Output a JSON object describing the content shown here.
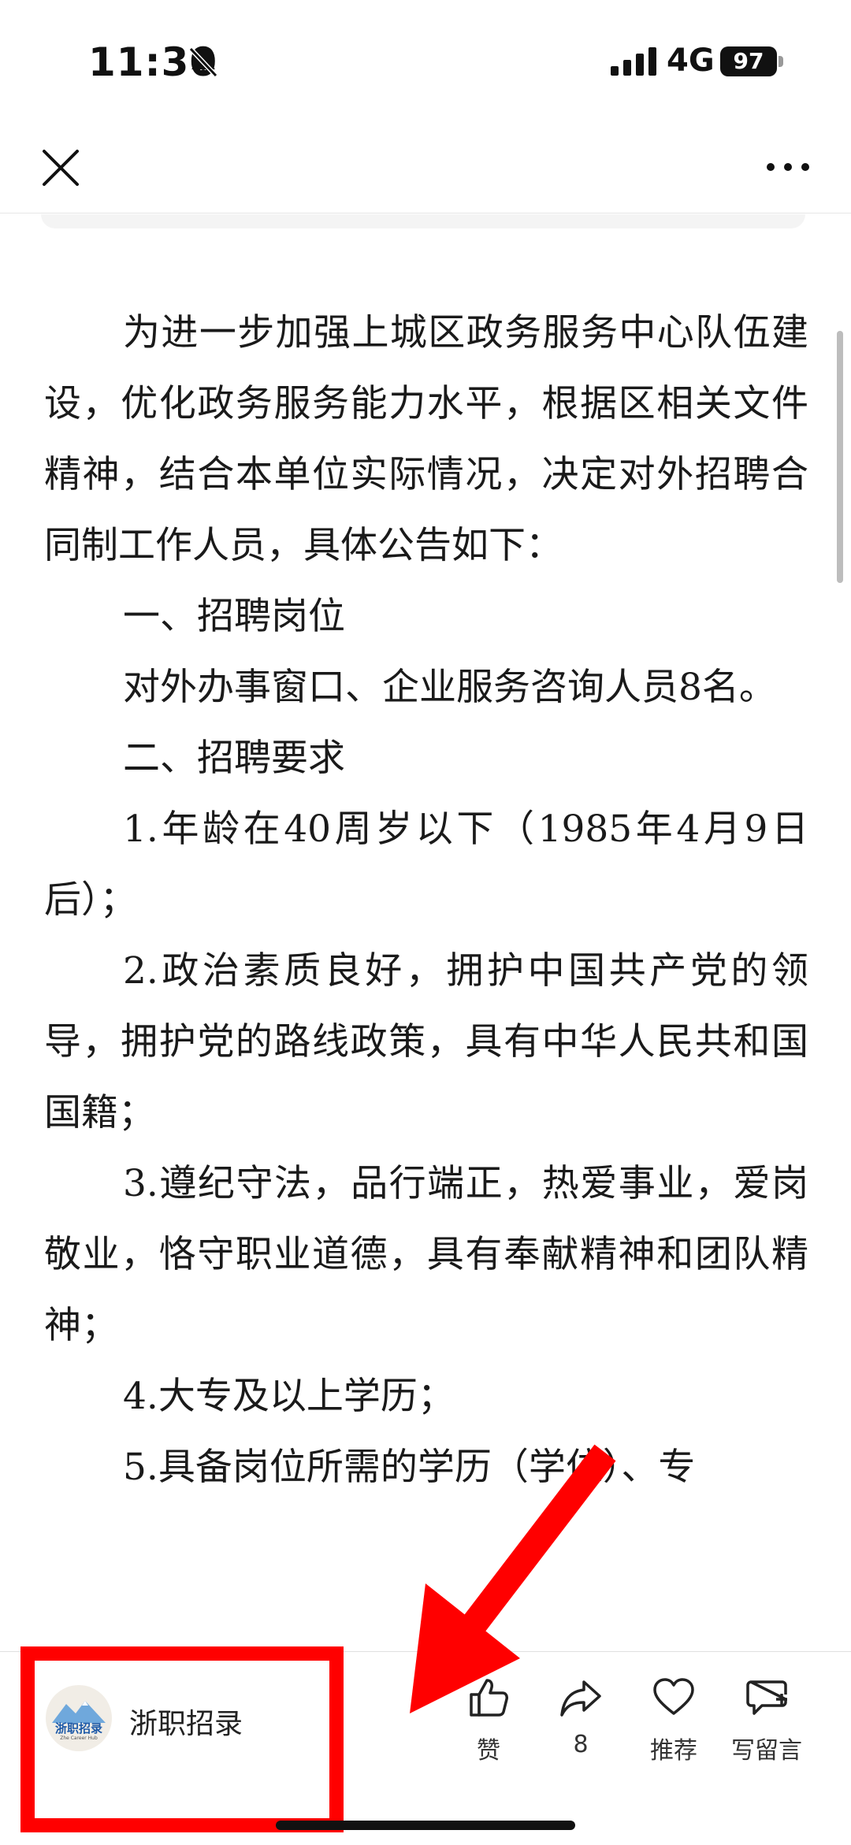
{
  "status_bar": {
    "time": "11:30",
    "network": "4G",
    "battery": "97"
  },
  "article": {
    "paragraphs": [
      "为进一步加强上城区政务服务中心队伍建设，优化政务服务能力水平，根据区相关文件精神，结合本单位实际情况，决定对外招聘合同制工作人员，具体公告如下：",
      "一、招聘岗位",
      "对外办事窗口、企业服务咨询人员8名。",
      "二、招聘要求",
      "1.年龄在40周岁以下（1985年4月9日后）；",
      "2.政治素质良好，拥护中国共产党的领导，拥护党的路线政策，具有中华人民共和国国籍；",
      "3.遵纪守法，品行端正，热爱事业，爱岗敬业，恪守职业道德，具有奉献精神和团队精神；",
      "4.大专及以上学历；",
      "5.具备岗位所需的学历（学位）、专"
    ]
  },
  "account": {
    "name": "浙职招录",
    "logo_text": "浙职招录",
    "logo_subtext": "Zhe Career Hub"
  },
  "actions": {
    "like": "赞",
    "share_count": "8",
    "recommend": "推荐",
    "comment": "写留言"
  },
  "colors": {
    "highlight": "#ff0000",
    "logo_blue": "#1e5aa8"
  },
  "icons": [
    "bell-muted-icon",
    "signal-icon",
    "battery-icon",
    "close-icon",
    "more-icon",
    "thumbs-up-icon",
    "share-icon",
    "heart-icon",
    "comment-icon",
    "arrow-annotation"
  ]
}
